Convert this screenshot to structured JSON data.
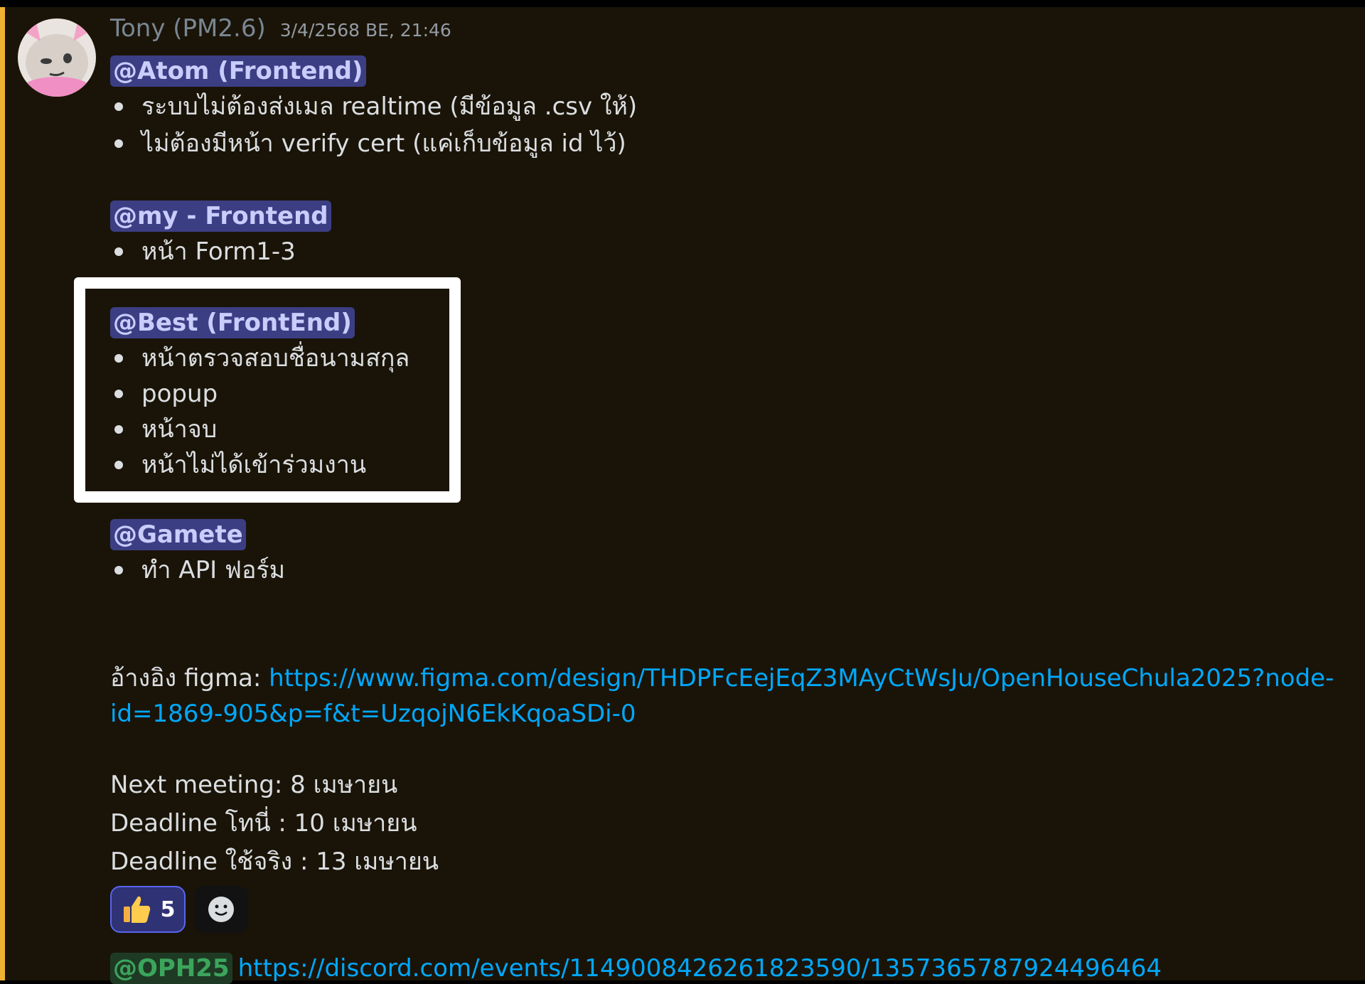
{
  "message": {
    "author": "Tony (PM2.6)",
    "timestamp": "3/4/2568 BE, 21:46",
    "accent_color": "#f0b232"
  },
  "sections": [
    {
      "mention": "@Atom (Frontend)",
      "items": [
        "ระบบไม่ต้องส่งเมล realtime (มีข้อมูล .csv ให้)",
        "ไม่ต้องมีหน้า verify cert (แค่เก็บข้อมูล id ไว้)"
      ]
    },
    {
      "mention": "@my - Frontend",
      "items": [
        "หน้า Form1-3"
      ]
    },
    {
      "mention": "@Best (FrontEnd)",
      "items": [
        "หน้าตรวจสอบชื่อนามสกุล",
        "popup",
        "หน้าจบ",
        "หน้าไม่ได้เข้าร่วมงาน"
      ]
    },
    {
      "mention": "@Gamete",
      "items": [
        "ทำ API ฟอร์ม"
      ]
    }
  ],
  "reference": {
    "label": "อ้างอิง figma: ",
    "url_line1": "https://www.figma.com/design/THDPFcEejEqZ3MAyCtWsJu/OpenHouseChula2025?node-",
    "url_line2": "id=1869-905&p=f&t=UzqojN6EkKqoaSDi-0"
  },
  "schedule": {
    "next_meeting": "Next meeting: 8 เมษายน",
    "deadline_test": "Deadline โทนี่ : 10 เมษายน",
    "deadline_real": "Deadline ใช้จริง : 13 เมษายน"
  },
  "reactions": {
    "emoji": "thumbs-up",
    "count": "5"
  },
  "footer": {
    "mention": "@OPH25",
    "url": "https://discord.com/events/1149008426261823590/1357365787924496464"
  }
}
